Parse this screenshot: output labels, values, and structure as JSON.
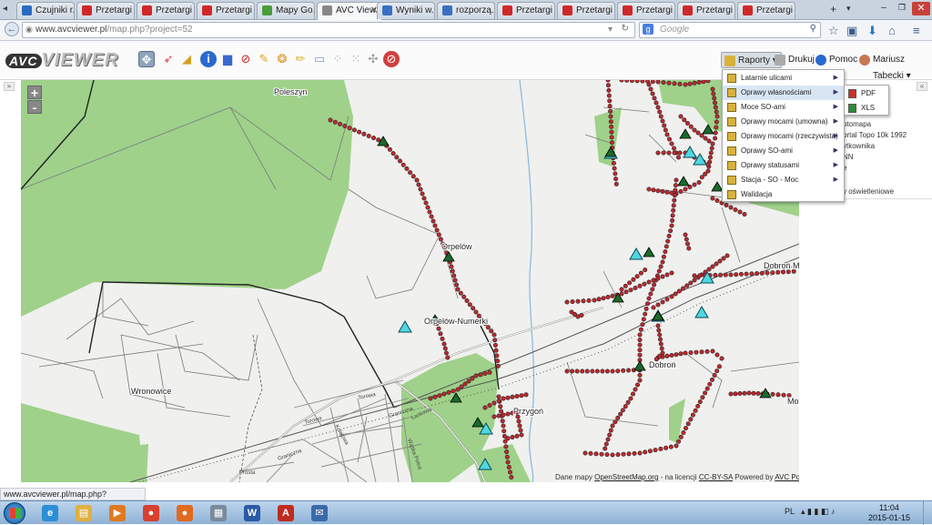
{
  "browser": {
    "tabs": [
      {
        "label": "Czujniki r...",
        "favicon_color": "#2a6bc4"
      },
      {
        "label": "Przetargi ...",
        "favicon_color": "#d02828"
      },
      {
        "label": "Przetargi ...",
        "favicon_color": "#d02828"
      },
      {
        "label": "Przetargi ...",
        "favicon_color": "#d02828"
      },
      {
        "label": "Mapy Go...",
        "favicon_color": "#4a9c3a"
      },
      {
        "label": "AVC View...",
        "favicon_color": "#888888",
        "active": true
      },
      {
        "label": "Wyniki w...",
        "favicon_color": "#3a6fc2"
      },
      {
        "label": "rozporzą...",
        "favicon_color": "#3a6fc2"
      },
      {
        "label": "Przetargi ...",
        "favicon_color": "#d02828"
      },
      {
        "label": "Przetargi ...",
        "favicon_color": "#d02828"
      },
      {
        "label": "Przetargi ...",
        "favicon_color": "#d02828"
      },
      {
        "label": "Przetargi ...",
        "favicon_color": "#d02828"
      },
      {
        "label": "Przetargi ...",
        "favicon_color": "#d02828"
      }
    ],
    "new_tab_label": "+",
    "url_domain": "www.avcviewer.pl",
    "url_path": "/map.php?project=52",
    "search_placeholder": "Google",
    "status_url": "www.avcviewer.pl/map.php?project=52#"
  },
  "app": {
    "logo_text_1": "AVC",
    "logo_text_2": "VIEWER",
    "reports_button": "Raporty",
    "print_button": "Drukuj",
    "help_button": "Pomoc",
    "user_name": "Mariusz Tabecki"
  },
  "reports_menu": {
    "items": [
      {
        "label": "Latarnie ulicami",
        "has_sub": true
      },
      {
        "label": "Oprawy własnościami",
        "has_sub": true,
        "highlighted": true
      },
      {
        "label": "Moce SO-ami",
        "has_sub": true
      },
      {
        "label": "Oprawy mocami (umowna)",
        "has_sub": true
      },
      {
        "label": "Oprawy mocami (rzeczywista)",
        "has_sub": true
      },
      {
        "label": "Oprawy SO-ami",
        "has_sub": true
      },
      {
        "label": "Oprawy statusami",
        "has_sub": true
      },
      {
        "label": "Stacja - SO - Moc",
        "has_sub": true
      },
      {
        "label": "Walidacja",
        "has_sub": false
      }
    ],
    "submenu": [
      {
        "label": "PDF",
        "color": "#c8302a"
      },
      {
        "label": "XLS",
        "color": "#2f8a3a"
      }
    ]
  },
  "sidebar": {
    "layers": [
      "ptomapa",
      "ortal Topo 10k 1992",
      "ytkownika",
      "NN",
      "e",
      "y oświetleniowe"
    ]
  },
  "map": {
    "places": [
      {
        "name": "Poleszyn"
      },
      {
        "name": "Orpelów"
      },
      {
        "name": "Orpelów-Numerki"
      },
      {
        "name": "Wronowice"
      },
      {
        "name": "Przygoń"
      },
      {
        "name": "Dobroń M"
      },
      {
        "name": "Dobroń"
      },
      {
        "name": "Mo"
      }
    ],
    "streets": [
      "Torowa",
      "Torowa",
      "Graniczna",
      "Graniczna",
      "Łaskowa",
      "Kolejowa",
      "Prosta",
      "Wąska Polna"
    ],
    "attribution_prefix": "Dane mapy",
    "attribution_osm": "OpenStreetMap.org",
    "attribution_mid": "- na licencji",
    "attribution_license": "CC-BY-SA",
    "attribution_powered": "Powered by",
    "attribution_company": "AVC Polska",
    "zoom_in": "+",
    "zoom_out": "-"
  },
  "taskbar": {
    "apps": [
      {
        "name": "ie",
        "glyph": "e",
        "color": "#2a8fd8"
      },
      {
        "name": "explorer",
        "glyph": "▤",
        "color": "#e0b040"
      },
      {
        "name": "media",
        "glyph": "▶",
        "color": "#e07a20"
      },
      {
        "name": "chrome",
        "glyph": "●",
        "color": "#d84030"
      },
      {
        "name": "firefox",
        "glyph": "●",
        "color": "#e06a20"
      },
      {
        "name": "calculator",
        "glyph": "▦",
        "color": "#7a8a9a"
      },
      {
        "name": "word",
        "glyph": "W",
        "color": "#2a5aa8"
      },
      {
        "name": "acrobat",
        "glyph": "A",
        "color": "#c02a20"
      },
      {
        "name": "thunderbird",
        "glyph": "✉",
        "color": "#3a6aa8"
      }
    ],
    "language": "PL",
    "time": "11:04",
    "date": "2015-01-15"
  },
  "colors": {
    "forest": "#9fd18a",
    "water": "#b3d6ef",
    "lamp": "#c0282e",
    "station_fill": "#4fd7e0",
    "station_dark": "#1a6a2a"
  }
}
